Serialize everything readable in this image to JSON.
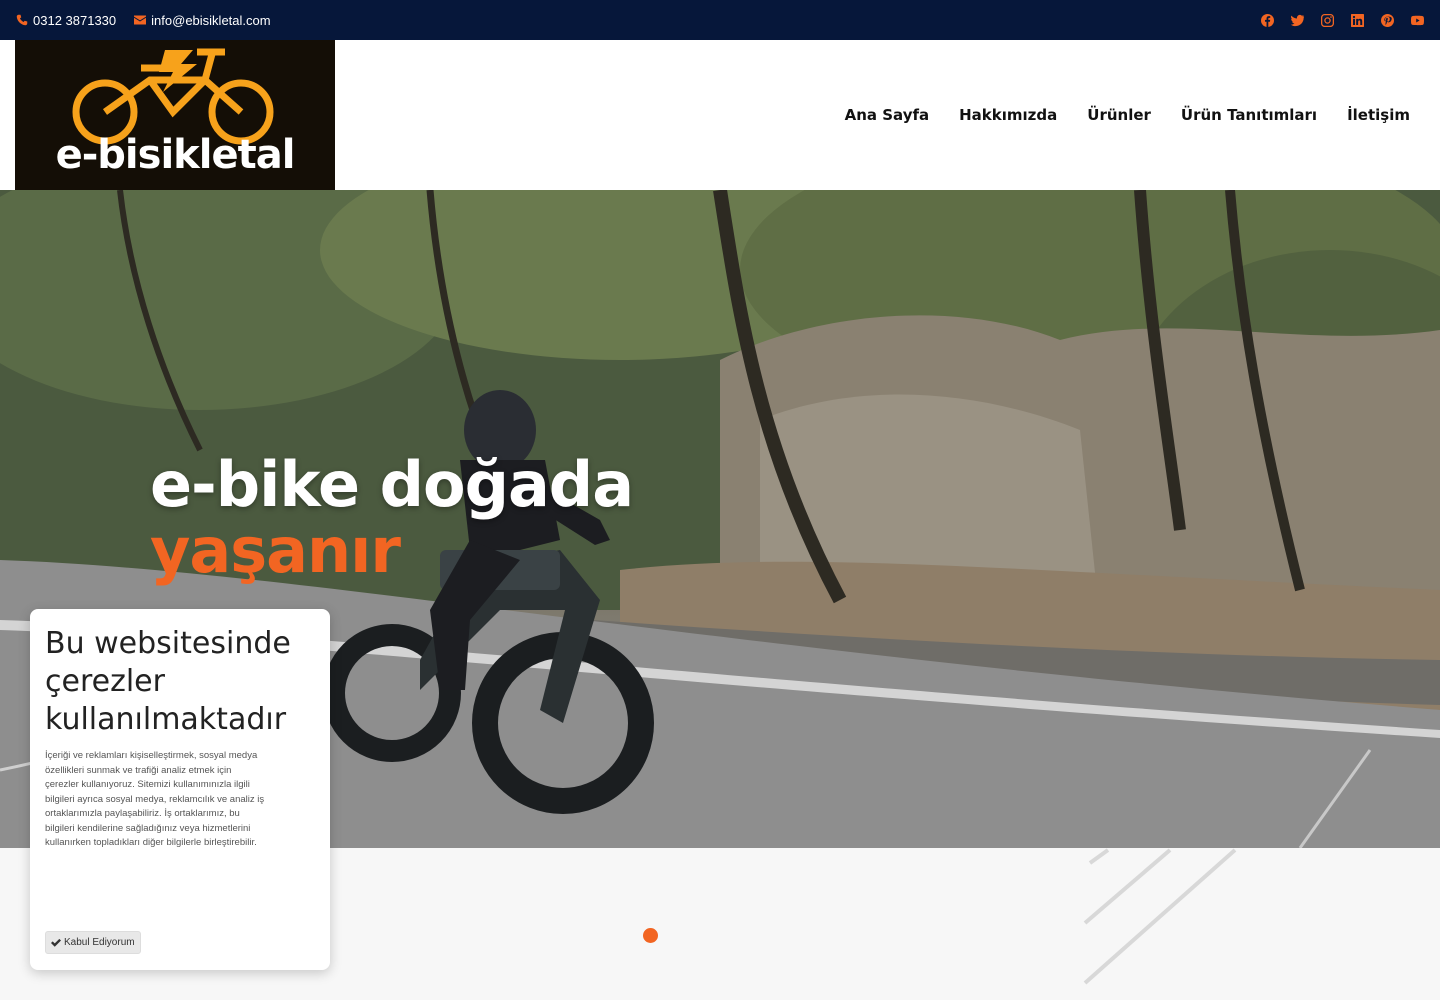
{
  "topbar": {
    "phone": "0312 3871330",
    "email": "info@ebisikletal.com",
    "social": [
      "facebook-icon",
      "twitter-icon",
      "instagram-icon",
      "linkedin-icon",
      "pinterest-icon",
      "youtube-icon"
    ]
  },
  "header": {
    "logo_text": "e-bisikletal",
    "nav": [
      "Ana Sayfa",
      "Hakkımızda",
      "Ürünler",
      "Ürün Tanıtımları",
      "İletişim"
    ]
  },
  "hero": {
    "title_line1": "e-bike doğada",
    "title_line2": "yaşanır"
  },
  "cookie": {
    "title": "Bu websitesinde çerezler kullanılmaktadır",
    "text": "İçeriği ve reklamları kişiselleştirmek, sosyal medya özellikleri sunmak ve trafiği analiz etmek için çerezler kullanıyoruz. Sitemizi kullanımınızla ilgili bilgileri ayrıca sosyal medya, reklamcılık ve analiz iş ortaklarımızla paylaşabiliriz. İş ortaklarımız, bu bilgileri kendilerine sağladığınız veya hizmetlerini kullanırken topladıkları diğer bilgilerle birleştirebilir.",
    "accept_label": "Kabul Ediyorum"
  },
  "colors": {
    "accent": "#f26522",
    "topbar_bg": "#06173a"
  }
}
